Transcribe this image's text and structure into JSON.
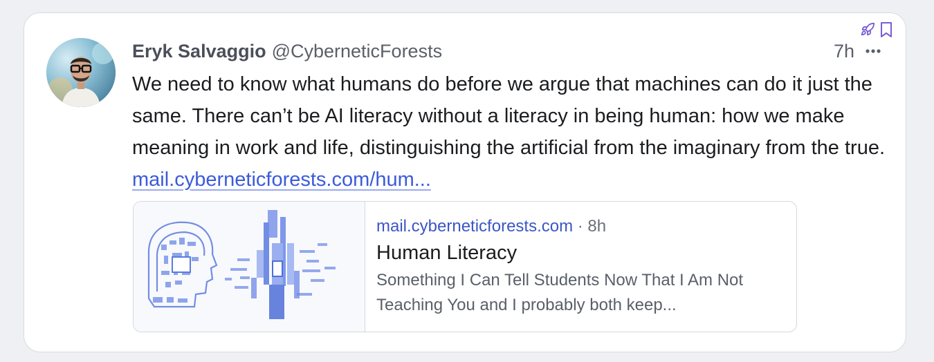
{
  "post": {
    "author_name": "Eryk Salvaggio",
    "author_handle": "@CyberneticForests",
    "time": "7h",
    "text": "We need to know what humans do before we argue that machines can do it just the same. There can’t be AI literacy without a literacy in being human: how we make meaning in work and life, distinguishing the artificial from the imaginary from the true.",
    "link_text": "mail.cyberneticforests.com/hum...",
    "icons": [
      "rocket-icon",
      "bookmark-icon",
      "more-icon"
    ]
  },
  "embed": {
    "domain": "mail.cyberneticforests.com",
    "ago": "· 8h",
    "title": "Human Literacy",
    "description": "Something I Can Tell Students Now That I Am Not Teaching You and I probably both keep..."
  },
  "colors": {
    "link": "#3b5bdb",
    "embed_domain": "#3b56c4",
    "accent_icon": "#7b5cd6"
  }
}
